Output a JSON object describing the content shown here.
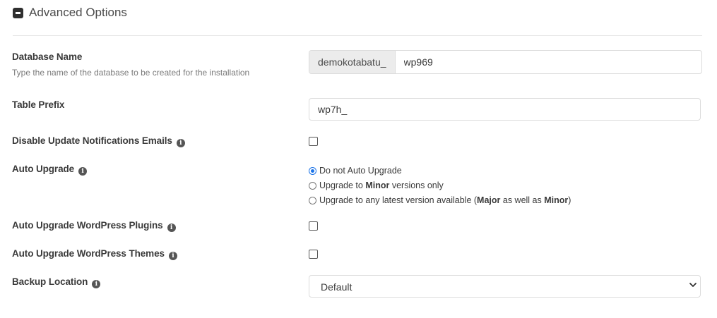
{
  "section": {
    "title": "Advanced Options"
  },
  "database_name": {
    "label": "Database Name",
    "hint": "Type the name of the database to be created for the installation",
    "prefix": "demokotabatu_",
    "value": "wp969"
  },
  "table_prefix": {
    "label": "Table Prefix",
    "value": "wp7h_"
  },
  "disable_update_emails": {
    "label": "Disable Update Notifications Emails",
    "checked": false
  },
  "auto_upgrade": {
    "label": "Auto Upgrade",
    "options": [
      {
        "text": "Do not Auto Upgrade",
        "selected": true
      },
      {
        "pre": "Upgrade to ",
        "bold1": "Minor",
        "post": " versions only",
        "selected": false
      },
      {
        "pre": "Upgrade to any latest version available (",
        "bold1": "Major",
        "mid": " as well as ",
        "bold2": "Minor",
        "post": ")",
        "selected": false
      }
    ]
  },
  "auto_upgrade_plugins": {
    "label": "Auto Upgrade WordPress Plugins",
    "checked": false
  },
  "auto_upgrade_themes": {
    "label": "Auto Upgrade WordPress Themes",
    "checked": false
  },
  "backup_location": {
    "label": "Backup Location",
    "selected": "Default"
  },
  "icons": {
    "section_toggle": "minus-square-icon",
    "info": "info-circle-icon",
    "select_chevron": "chevron-down-icon"
  },
  "colors": {
    "radio_accent": "#1a73e8",
    "addon_bg": "#ececec"
  }
}
